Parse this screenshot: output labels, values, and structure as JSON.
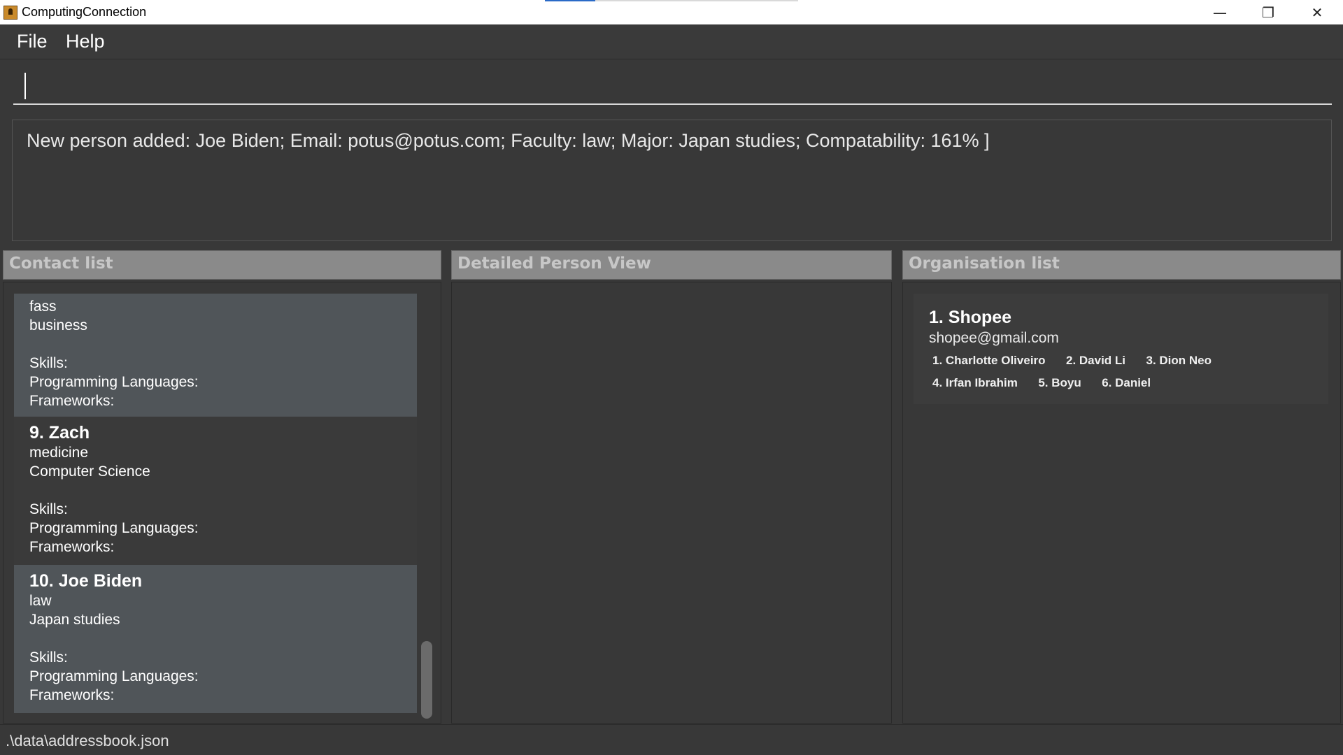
{
  "window": {
    "title": "ComputingConnection",
    "controls": {
      "minimize": "—",
      "maximize": "❐",
      "close": "✕"
    }
  },
  "menu": {
    "file": "File",
    "help": "Help"
  },
  "command": {
    "value": "",
    "placeholder": ""
  },
  "result": {
    "text": "New person added: Joe Biden; Email: potus@potus.com; Faculty: law; Major: Japan studies; Compatability: 161% ]"
  },
  "panels": {
    "contacts_title": "Contact list",
    "detail_title": "Detailed Person View",
    "orgs_title": "Organisation list"
  },
  "contacts": [
    {
      "name": "",
      "faculty": "fass",
      "major": "business",
      "skills": "Skills:",
      "languages": "Programming Languages:",
      "frameworks": "Frameworks:"
    },
    {
      "name": "9.  Zach",
      "faculty": "medicine",
      "major": "Computer Science",
      "skills": "Skills:",
      "languages": "Programming Languages:",
      "frameworks": "Frameworks:"
    },
    {
      "name": "10.  Joe Biden",
      "faculty": "law",
      "major": "Japan studies",
      "skills": "Skills:",
      "languages": "Programming Languages:",
      "frameworks": "Frameworks:"
    }
  ],
  "organisations": [
    {
      "name": "1.  Shopee",
      "email": "shopee@gmail.com",
      "members": [
        "1. Charlotte Oliveiro",
        "2. David Li",
        "3. Dion Neo",
        "4. Irfan Ibrahim",
        "5. Boyu",
        "6. Daniel"
      ]
    }
  ],
  "status": {
    "path": ".\\data\\addressbook.json"
  }
}
